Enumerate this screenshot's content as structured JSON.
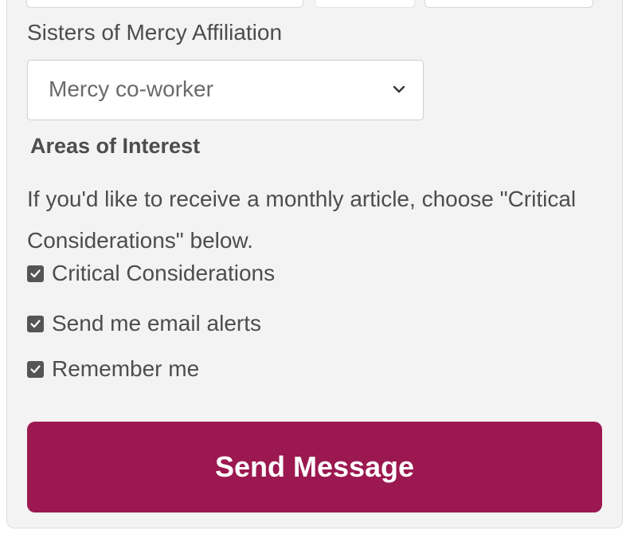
{
  "affiliation": {
    "label": "Sisters of Mercy Affiliation",
    "selected": "Mercy co-worker",
    "chevron_icon": "chevron-down-icon"
  },
  "interests": {
    "heading": "Areas of Interest",
    "description": "If you'd like to receive a monthly article, choose \"Critical Considerations\" below.",
    "options": [
      {
        "label": "Critical Considerations",
        "checked": true
      },
      {
        "label": "Send me email alerts",
        "checked": true
      },
      {
        "label": "Remember me",
        "checked": true
      }
    ]
  },
  "submit": {
    "label": "Send Message",
    "color": "#9b1850"
  }
}
